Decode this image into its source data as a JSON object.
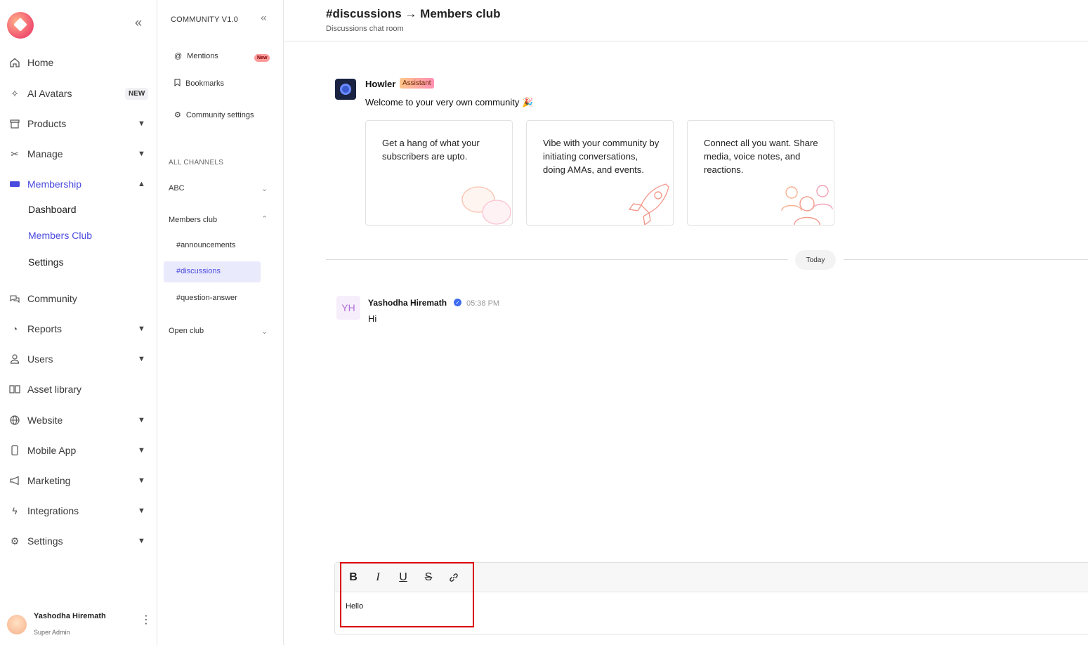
{
  "nav": {
    "collapse_icon": "double-chevron-left-icon",
    "items": [
      {
        "label": "Home",
        "icon": "home-icon"
      },
      {
        "label": "AI Avatars",
        "icon": "sparkle-icon",
        "badge": "NEW"
      },
      {
        "label": "Products",
        "icon": "box-icon"
      },
      {
        "label": "Manage",
        "icon": "tools-icon"
      },
      {
        "label": "Membership",
        "icon": "ticket-icon"
      },
      {
        "label": "Community",
        "icon": "chat-icon"
      },
      {
        "label": "Reports",
        "icon": "pie-chart-icon"
      },
      {
        "label": "Users",
        "icon": "user-icon"
      },
      {
        "label": "Asset library",
        "icon": "book-icon"
      },
      {
        "label": "Website",
        "icon": "globe-icon"
      },
      {
        "label": "Mobile App",
        "icon": "phone-icon"
      },
      {
        "label": "Marketing",
        "icon": "megaphone-icon"
      },
      {
        "label": "Integrations",
        "icon": "bolt-icon"
      },
      {
        "label": "Settings",
        "icon": "gear-icon"
      }
    ],
    "membership_sub": [
      {
        "label": "Dashboard"
      },
      {
        "label": "Members Club"
      },
      {
        "label": "Settings"
      }
    ],
    "user": {
      "name": "Yashodha Hiremath",
      "role": "Super Admin"
    }
  },
  "channels": {
    "title": "COMMUNITY V1.0",
    "top": [
      {
        "label": "Mentions",
        "badge": "New"
      },
      {
        "label": "Bookmarks"
      },
      {
        "label": "Community settings"
      }
    ],
    "section_label": "ALL CHANNELS",
    "groups": [
      {
        "label": "ABC"
      },
      {
        "label": "Members club"
      },
      {
        "label": "Open club"
      }
    ],
    "members_club_channels": [
      "#announcements",
      "#discussions",
      "#question-answer"
    ]
  },
  "main": {
    "title": "#discussions → Members club",
    "subtitle": "Discussions chat room",
    "bot": {
      "name": "Howler",
      "tag": "Assistant",
      "message": "Welcome to your very own community 🎉"
    },
    "cards": [
      {
        "text": "Get a hang of what your subscribers are upto."
      },
      {
        "text": "Vibe with your community by initiating conversations, doing AMAs, and events."
      },
      {
        "text": "Connect all you want. Share media, voice notes, and reactions."
      }
    ],
    "date_divider": "Today",
    "message": {
      "initials": "YH",
      "author": "Yashodha Hiremath",
      "time": "05:38 PM",
      "text": "Hi"
    },
    "composer": {
      "tools": [
        "B",
        "I",
        "U",
        "S",
        "link"
      ],
      "value": "Hello"
    }
  },
  "colors": {
    "accent": "#4b4be0",
    "highlight": "#d9000d"
  }
}
